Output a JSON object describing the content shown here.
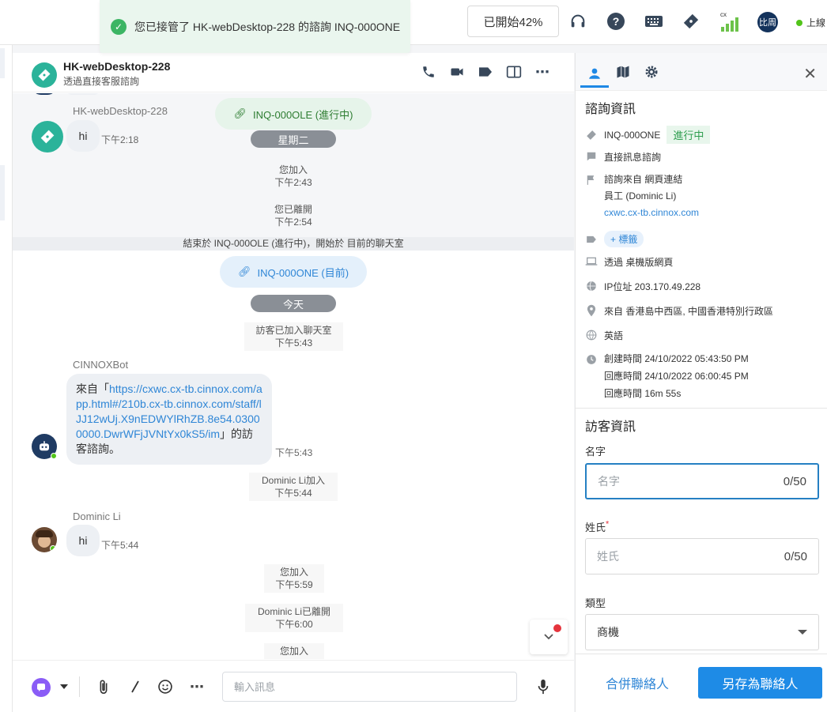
{
  "toast": {
    "message": "您已接管了 HK-webDesktop-228 的諮詢 INQ-000ONE"
  },
  "topbar": {
    "progress_label": "已開始42%",
    "signal_label": "cx",
    "avatar_text": "比周",
    "status_label": "上線"
  },
  "chat": {
    "header": {
      "title": "HK-webDesktop-228",
      "subtitle": "透過直接客服諮詢"
    },
    "old": {
      "sender": "HK-webDesktop-228",
      "message": "hi",
      "time": "下午2:18",
      "inquiry_pill": "INQ-000OLE (進行中)",
      "day_label": "星期二",
      "sys1": {
        "text": "您加入",
        "time": "下午2:43"
      },
      "sys2": {
        "text": "您已離開",
        "time": "下午2:54"
      }
    },
    "divider_text": "結束於 INQ-000OLE (進行中)，開始於 目前的聊天室",
    "current": {
      "inquiry_pill": "INQ-000ONE (目前)",
      "day_label": "今天",
      "sys_visitor_joined": {
        "text": "訪客已加入聊天室",
        "time": "下午5:43"
      },
      "bot": {
        "sender": "CINNOXBot",
        "prefix": "來自「",
        "link": "https://cxwc.cx-tb.cinnox.com/app.html#/210b.cx-tb.cinnox.com/staff/lJJ12wUj.X9nEDWYlRhZB.8e54.03000000.DwrWFjJVNtYx0kS5/im",
        "suffix": "」的訪客諮詢。",
        "time": "下午5:43"
      },
      "sys_dominic_joined": {
        "text": "Dominic Li加入",
        "time": "下午5:44"
      },
      "dominic": {
        "sender": "Dominic Li",
        "message": "hi",
        "time": "下午5:44"
      },
      "sys_you_joined": {
        "text": "您加入",
        "time": "下午5:59"
      },
      "sys_dominic_left": {
        "text": "Dominic Li已離開",
        "time": "下午6:00"
      },
      "sys_you_joined2": {
        "text": "您加入"
      }
    },
    "composer": {
      "placeholder": "輸入訊息"
    }
  },
  "panel": {
    "inquiry_section": {
      "title": "諮詢資訊",
      "inquiry_id": "INQ-000ONE",
      "status": "進行中",
      "type": "直接訊息諮詢",
      "source": "諮詢來自 網頁連結",
      "staff": "員工 (Dominic Li)",
      "source_url": "cxwc.cx-tb.cinnox.com",
      "tag_button": "+ 標籤",
      "via": "透過 桌機版網頁",
      "ip": "IP位址 203.170.49.228",
      "location": "來自 香港島中西區, 中國香港特別行政區",
      "language": "英語",
      "created": "創建時間 24/10/2022 05:43:50 PM",
      "responded": "回應時間 24/10/2022 06:00:45 PM",
      "response_time": "回應時間 16m 55s"
    },
    "visitor_section": {
      "title": "訪客資訊",
      "first_name_label": "名字",
      "first_name_placeholder": "名字",
      "first_name_count": "0/50",
      "last_name_label": "姓氏",
      "last_name_required": "*",
      "last_name_placeholder": "姓氏",
      "last_name_count": "0/50",
      "type_label": "類型",
      "type_value": "商機"
    },
    "footer": {
      "merge": "合併聯絡人",
      "save": "另存為聯絡人"
    }
  },
  "colors": {
    "accent": "#1e8be6",
    "brand_green": "#2bb39a",
    "online": "#52c41a",
    "alert": "#e5343d"
  }
}
